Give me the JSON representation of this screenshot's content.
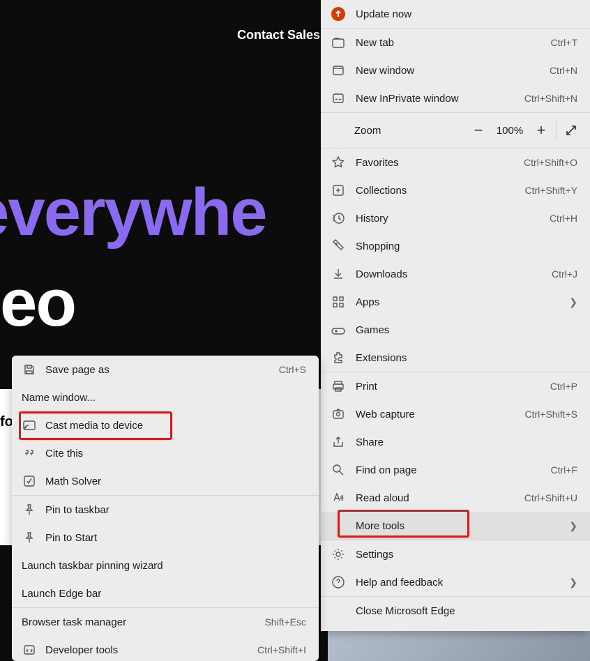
{
  "page": {
    "contact_sales": "Contact Sales",
    "hero1": "everywhe",
    "hero2": "eo",
    "fo_fragment": "fo"
  },
  "main_menu": {
    "update": "Update now",
    "new_tab": {
      "label": "New tab",
      "shortcut": "Ctrl+T"
    },
    "new_window": {
      "label": "New window",
      "shortcut": "Ctrl+N"
    },
    "new_inprivate": {
      "label": "New InPrivate window",
      "shortcut": "Ctrl+Shift+N"
    },
    "zoom": {
      "label": "Zoom",
      "pct": "100%"
    },
    "favorites": {
      "label": "Favorites",
      "shortcut": "Ctrl+Shift+O"
    },
    "collections": {
      "label": "Collections",
      "shortcut": "Ctrl+Shift+Y"
    },
    "history": {
      "label": "History",
      "shortcut": "Ctrl+H"
    },
    "shopping": {
      "label": "Shopping"
    },
    "downloads": {
      "label": "Downloads",
      "shortcut": "Ctrl+J"
    },
    "apps": {
      "label": "Apps"
    },
    "games": {
      "label": "Games"
    },
    "extensions": {
      "label": "Extensions"
    },
    "print": {
      "label": "Print",
      "shortcut": "Ctrl+P"
    },
    "web_capture": {
      "label": "Web capture",
      "shortcut": "Ctrl+Shift+S"
    },
    "share": {
      "label": "Share"
    },
    "find": {
      "label": "Find on page",
      "shortcut": "Ctrl+F"
    },
    "read_aloud": {
      "label": "Read aloud",
      "shortcut": "Ctrl+Shift+U"
    },
    "more_tools": {
      "label": "More tools"
    },
    "settings": {
      "label": "Settings"
    },
    "help": {
      "label": "Help and feedback"
    },
    "close": {
      "label": "Close Microsoft Edge"
    }
  },
  "submenu": {
    "save_as": {
      "label": "Save page as",
      "shortcut": "Ctrl+S"
    },
    "name_window": {
      "label": "Name window..."
    },
    "cast": {
      "label": "Cast media to device"
    },
    "cite": {
      "label": "Cite this"
    },
    "math": {
      "label": "Math Solver"
    },
    "pin_taskbar": {
      "label": "Pin to taskbar"
    },
    "pin_start": {
      "label": "Pin to Start"
    },
    "launch_taskbar_wizard": {
      "label": "Launch taskbar pinning wizard"
    },
    "launch_edge_bar": {
      "label": "Launch Edge bar"
    },
    "task_manager": {
      "label": "Browser task manager",
      "shortcut": "Shift+Esc"
    },
    "dev_tools": {
      "label": "Developer tools",
      "shortcut": "Ctrl+Shift+I"
    }
  }
}
